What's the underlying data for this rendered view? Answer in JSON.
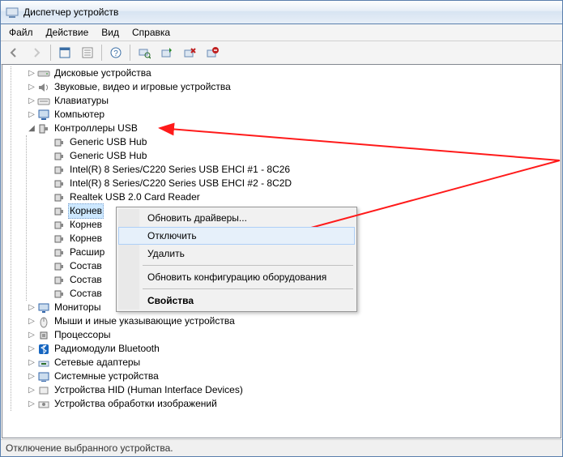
{
  "window": {
    "title": "Диспетчер устройств"
  },
  "menu": {
    "file": "Файл",
    "action": "Действие",
    "view": "Вид",
    "help": "Справка"
  },
  "tree": {
    "n0": "Дисковые устройства",
    "n1": "Звуковые, видео и игровые устройства",
    "n2": "Клавиатуры",
    "n3": "Компьютер",
    "n4": "Контроллеры USB",
    "n4c0": "Generic USB Hub",
    "n4c1": "Generic USB Hub",
    "n4c2": "Intel(R) 8 Series/C220 Series USB EHCI #1 - 8C26",
    "n4c3": "Intel(R) 8 Series/C220 Series USB EHCI #2 - 8C2D",
    "n4c4": "Realtek USB 2.0 Card Reader",
    "n4c5": "Корнев",
    "n4c6": "Корнев",
    "n4c7": "Корнев",
    "n4c8": "Расшир",
    "n4c9": "Состав",
    "n4c10": "Состав",
    "n4c11": "Состав",
    "n5": "Мониторы",
    "n6": "Мыши и иные указывающие устройства",
    "n7": "Процессоры",
    "n8": "Радиомодули Bluetooth",
    "n9": "Сетевые адаптеры",
    "n10": "Системные устройства",
    "n11": "Устройства HID (Human Interface Devices)",
    "n12": "Устройства обработки изображений"
  },
  "context_menu": {
    "update_drivers": "Обновить драйверы...",
    "disable": "Отключить",
    "delete": "Удалить",
    "scan_hw": "Обновить конфигурацию оборудования",
    "properties": "Свойства"
  },
  "statusbar": {
    "text": "Отключение выбранного устройства."
  }
}
